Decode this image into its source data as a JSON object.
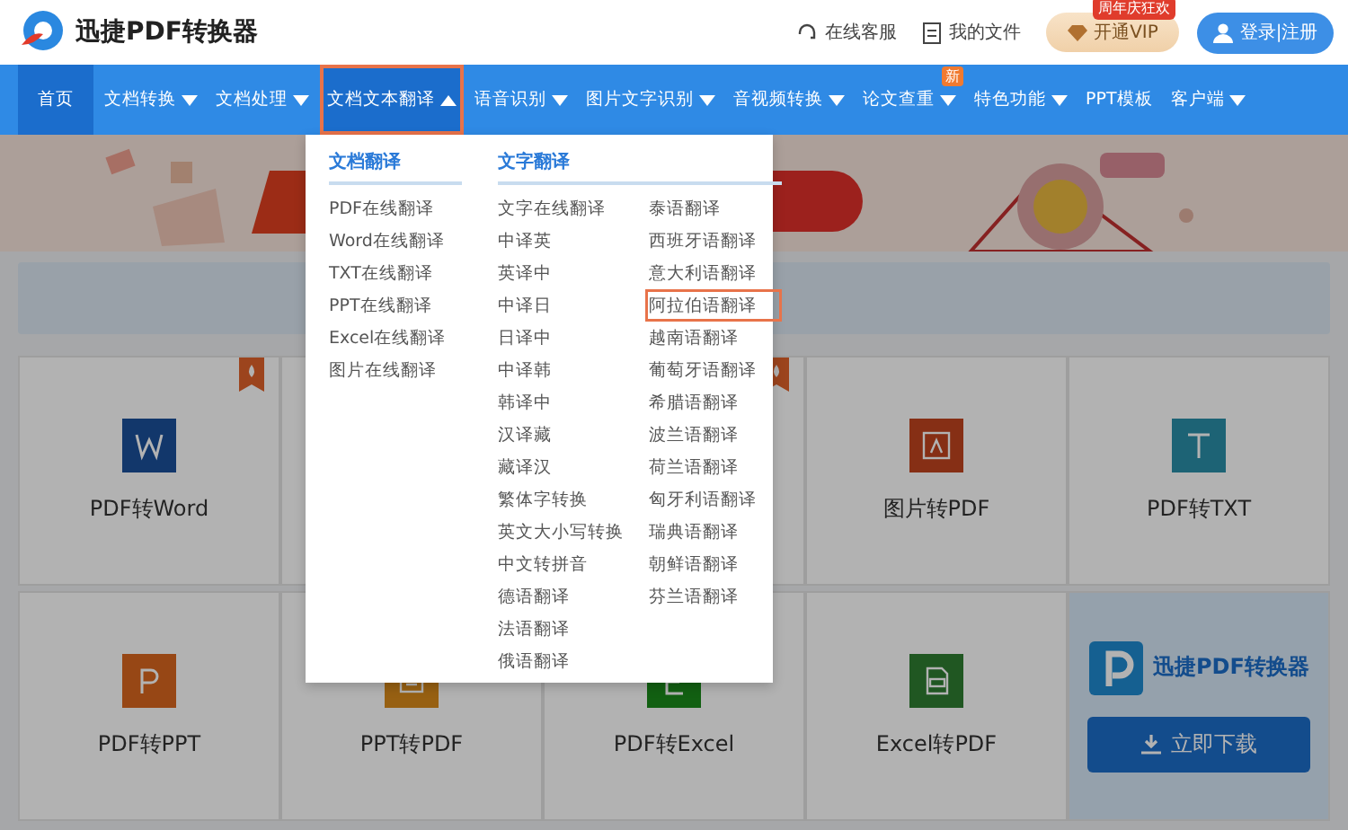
{
  "header": {
    "brand": "迅捷PDF转换器",
    "links": [
      {
        "kind": "support",
        "label": "在线客服"
      },
      {
        "kind": "files",
        "label": "我的文件"
      }
    ],
    "vip": {
      "label": "开通VIP",
      "badge": "周年庆狂欢"
    },
    "login": "登录|注册"
  },
  "nav": [
    {
      "label": "首页",
      "selected": true,
      "expanded": false,
      "caret": false,
      "highlighted": false
    },
    {
      "label": "文档转换",
      "selected": false,
      "expanded": false,
      "caret": true,
      "highlighted": false
    },
    {
      "label": "文档处理",
      "selected": false,
      "expanded": false,
      "caret": true,
      "highlighted": false
    },
    {
      "label": "文档文本翻译",
      "selected": false,
      "expanded": true,
      "caret": true,
      "highlighted": true
    },
    {
      "label": "语音识别",
      "selected": false,
      "expanded": false,
      "caret": true,
      "highlighted": false
    },
    {
      "label": "图片文字识别",
      "selected": false,
      "expanded": false,
      "caret": true,
      "highlighted": false
    },
    {
      "label": "音视频转换",
      "selected": false,
      "expanded": false,
      "caret": true,
      "highlighted": false
    },
    {
      "label": "论文查重",
      "selected": false,
      "expanded": false,
      "caret": true,
      "highlighted": false,
      "badge": "新"
    },
    {
      "label": "特色功能",
      "selected": false,
      "expanded": false,
      "caret": true,
      "highlighted": false
    },
    {
      "label": "PPT模板",
      "selected": false,
      "expanded": false,
      "caret": false,
      "highlighted": false
    },
    {
      "label": "客户端",
      "selected": false,
      "expanded": false,
      "caret": true,
      "highlighted": false
    }
  ],
  "dropdown": {
    "sections": [
      {
        "title": "文档翻译",
        "columns": [
          [
            {
              "label": "PDF在线翻译",
              "highlighted": false
            },
            {
              "label": "Word在线翻译",
              "highlighted": false
            },
            {
              "label": "TXT在线翻译",
              "highlighted": false
            },
            {
              "label": "PPT在线翻译",
              "highlighted": false
            },
            {
              "label": "Excel在线翻译",
              "highlighted": false
            },
            {
              "label": "图片在线翻译",
              "highlighted": false
            }
          ]
        ]
      },
      {
        "title": "文字翻译",
        "columns": [
          [
            {
              "label": "文字在线翻译",
              "highlighted": false
            },
            {
              "label": "中译英",
              "highlighted": false
            },
            {
              "label": "英译中",
              "highlighted": false
            },
            {
              "label": "中译日",
              "highlighted": false
            },
            {
              "label": "日译中",
              "highlighted": false
            },
            {
              "label": "中译韩",
              "highlighted": false
            },
            {
              "label": "韩译中",
              "highlighted": false
            },
            {
              "label": "汉译藏",
              "highlighted": false
            },
            {
              "label": "藏译汉",
              "highlighted": false
            },
            {
              "label": "繁体字转换",
              "highlighted": false
            },
            {
              "label": "英文大小写转换",
              "highlighted": false
            },
            {
              "label": "中文转拼音",
              "highlighted": false
            },
            {
              "label": "德语翻译",
              "highlighted": false
            },
            {
              "label": "法语翻译",
              "highlighted": false
            },
            {
              "label": "俄语翻译",
              "highlighted": false
            }
          ],
          [
            {
              "label": "泰语翻译",
              "highlighted": false
            },
            {
              "label": "西班牙语翻译",
              "highlighted": false
            },
            {
              "label": "意大利语翻译",
              "highlighted": false
            },
            {
              "label": "阿拉伯语翻译",
              "highlighted": true
            },
            {
              "label": "越南语翻译",
              "highlighted": false
            },
            {
              "label": "葡萄牙语翻译",
              "highlighted": false
            },
            {
              "label": "希腊语翻译",
              "highlighted": false
            },
            {
              "label": "波兰语翻译",
              "highlighted": false
            },
            {
              "label": "荷兰语翻译",
              "highlighted": false
            },
            {
              "label": "匈牙利语翻译",
              "highlighted": false
            },
            {
              "label": "瑞典语翻译",
              "highlighted": false
            },
            {
              "label": "朝鲜语翻译",
              "highlighted": false
            },
            {
              "label": "芬兰语翻译",
              "highlighted": false
            }
          ]
        ]
      }
    ]
  },
  "cards": [
    {
      "kind": "word",
      "label": "PDF转Word",
      "hot": true
    },
    {
      "kind": "covered",
      "hot": false
    },
    {
      "kind": "covered",
      "hot": true
    },
    {
      "kind": "image-pdf",
      "label": "图片转PDF",
      "hot": false
    },
    {
      "kind": "txt",
      "label": "PDF转TXT",
      "hot": false
    },
    {
      "kind": "ppt",
      "label": "PDF转PPT",
      "hot": false
    },
    {
      "kind": "ppt-pdf",
      "label": "PPT转PDF",
      "hot": false
    },
    {
      "kind": "excel",
      "label": "PDF转Excel",
      "hot": false
    },
    {
      "kind": "excel-pdf",
      "label": "Excel转PDF",
      "hot": false
    },
    {
      "kind": "promo",
      "brand": "迅捷PDF转换器",
      "button": "立即下载"
    }
  ]
}
